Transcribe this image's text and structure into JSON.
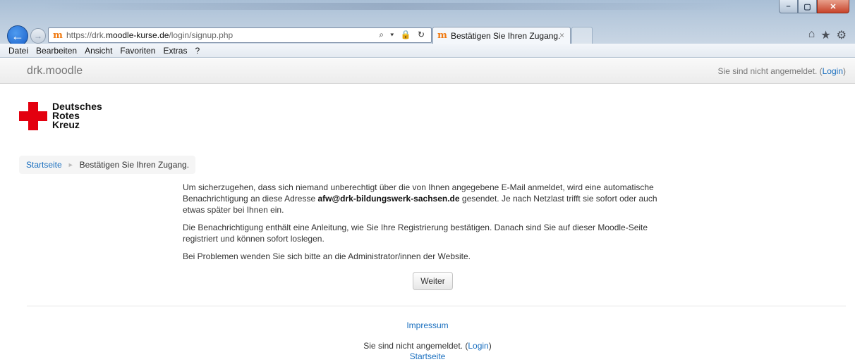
{
  "browser": {
    "url_prefix": "https://drk.",
    "url_domain": "moodle-kurse.de",
    "url_path": "/login/signup.php",
    "address_icons": "⌕ ▾ 🔒 ↻",
    "tab_title": "Bestätigen Sie Ihren Zugang.",
    "tab_close": "×",
    "favicon": "m",
    "menu": [
      "Datei",
      "Bearbeiten",
      "Ansicht",
      "Favoriten",
      "Extras",
      "?"
    ],
    "window_controls": {
      "minimize": "–",
      "maximize": "▢",
      "close": "✕"
    },
    "toolbar_icons": [
      "home-icon",
      "star-icon",
      "gear-icon"
    ]
  },
  "navbar": {
    "brand": "drk.moodle",
    "login_text": "Sie sind nicht angemeldet. (",
    "login_link": "Login",
    "login_close": ")"
  },
  "logo": {
    "line1": "Deutsches",
    "line2": "Rotes",
    "line3": "Kreuz",
    "colors": {
      "cross": "#e3000f"
    }
  },
  "breadcrumb": {
    "home": "Startseite",
    "separator": "►",
    "current": "Bestätigen Sie Ihren Zugang."
  },
  "main": {
    "p1_before": "Um sicherzugehen, dass sich niemand unberechtigt über die von Ihnen angegebene E-Mail anmeldet, wird eine automatische Benachrichtigung an diese Adresse ",
    "p1_email": "afw@drk-bildungswerk-sachsen.de",
    "p1_after": " gesendet. Je nach Netzlast trifft sie sofort oder auch etwas später bei Ihnen ein.",
    "p2": "Die Benachrichtigung enthält eine Anleitung, wie Sie Ihre Registrierung bestätigen. Danach sind Sie auf dieser Moodle-Seite registriert und können sofort loslegen.",
    "p3": "Bei Problemen wenden Sie sich bitte an die Administrator/innen der Website.",
    "button": "Weiter"
  },
  "footer": {
    "impressum": "Impressum",
    "login_text": "Sie sind nicht angemeldet. (",
    "login_link": "Login",
    "login_close": ")",
    "home": "Startseite"
  },
  "colors": {
    "link": "#1a6fbf",
    "accent_ie": "#1a5fc8"
  }
}
